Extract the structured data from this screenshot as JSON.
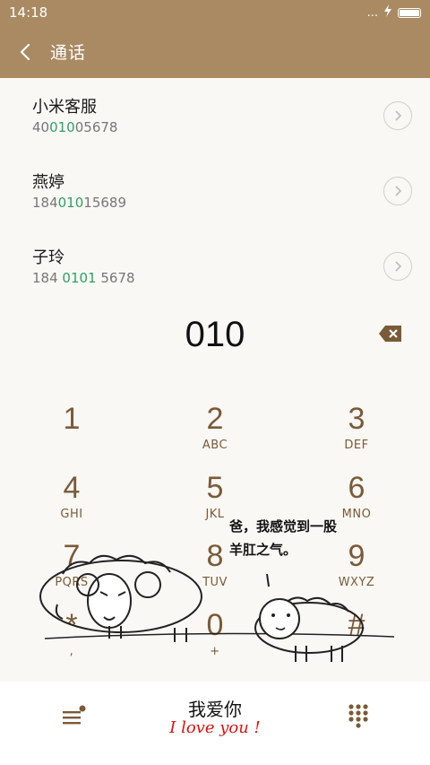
{
  "status": {
    "time": "14:18",
    "more": "..."
  },
  "header": {
    "title": "通话"
  },
  "contacts": [
    {
      "name": "小米客服",
      "num_pre": "40",
      "num_match": "010",
      "num_post": "05678"
    },
    {
      "name": "燕婷",
      "num_pre": "184",
      "num_match": "010",
      "num_post": "15689"
    },
    {
      "name": "子玲",
      "num_pre": "184 ",
      "num_match": "0101",
      "num_post": " 5678"
    }
  ],
  "dialer": {
    "input": "010",
    "keys": [
      {
        "digit": "1",
        "letters": ""
      },
      {
        "digit": "2",
        "letters": "ABC"
      },
      {
        "digit": "3",
        "letters": "DEF"
      },
      {
        "digit": "4",
        "letters": "GHI"
      },
      {
        "digit": "5",
        "letters": "JKL"
      },
      {
        "digit": "6",
        "letters": "MNO"
      },
      {
        "digit": "7",
        "letters": "PQRS"
      },
      {
        "digit": "8",
        "letters": "TUV"
      },
      {
        "digit": "9",
        "letters": "WXYZ"
      },
      {
        "digit": "*",
        "letters": ","
      },
      {
        "digit": "0",
        "letters": "+"
      },
      {
        "digit": "#",
        "letters": ""
      }
    ]
  },
  "theme": {
    "accent": "#a98a63",
    "key_color": "#7a5a38",
    "match_color": "#2ea066",
    "love_color": "#dd1111"
  },
  "comic": {
    "bubble_line1": "爸，我感觉到一股",
    "bubble_line2": "羊肛之气。"
  },
  "bottom": {
    "love_cn": "我爱你",
    "love_en": "I love you !"
  }
}
